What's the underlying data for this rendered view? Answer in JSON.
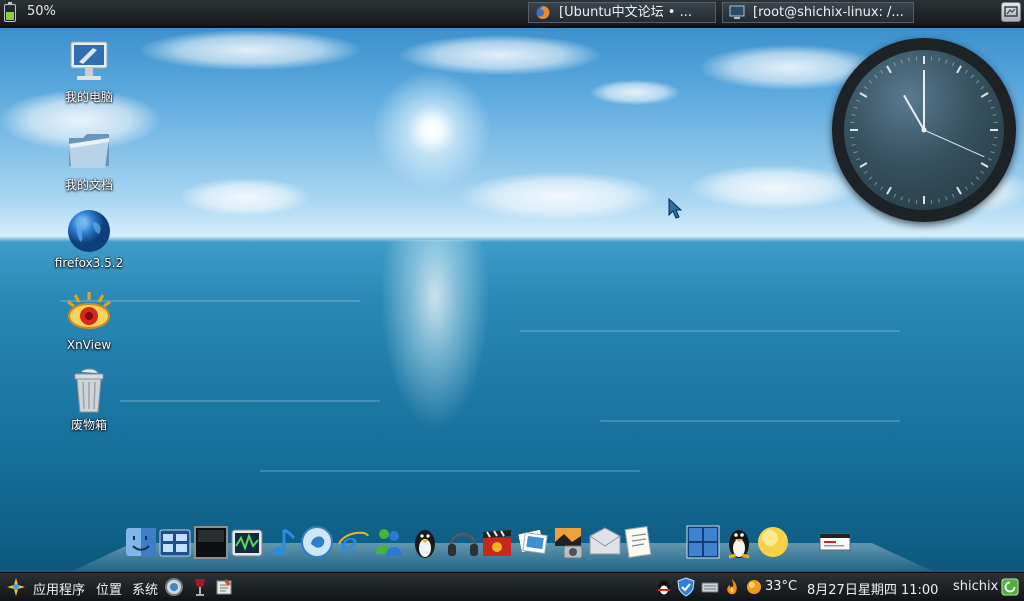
{
  "top_panel": {
    "battery_percent": "50%",
    "tasks": [
      {
        "label": "[Ubuntu中文论坛 • ...",
        "icon": "firefox-icon"
      },
      {
        "label": "[root@shichix-linux: /...",
        "icon": "terminal-icon"
      }
    ],
    "right_button_icon": "show-desktop-icon"
  },
  "desktop_icons": [
    {
      "label": "我的电脑",
      "icon": "computer-icon"
    },
    {
      "label": "我的文档",
      "icon": "folder-icon"
    },
    {
      "label": "firefox3.5.2",
      "icon": "globe-icon"
    },
    {
      "label": "XnView",
      "icon": "xnview-eye-icon"
    },
    {
      "label": "废物箱",
      "icon": "trash-icon"
    }
  ],
  "clock": {
    "hour": 11,
    "minute": 0
  },
  "dock": {
    "items": [
      "finder-icon",
      "window-list-icon",
      "black-screen-icon",
      "network-monitor-icon",
      "music-note-icon",
      "quicktime-icon",
      "internet-explorer-icon",
      "messenger-icon",
      "penguin-icon",
      "headphones-icon",
      "movie-clapper-icon",
      "photo-collection-icon",
      "camera-icon",
      "mail-icon",
      "notes-icon",
      "workspace-switcher-icon",
      "tux-icon",
      "weather-sun-icon",
      "calendar-icon"
    ]
  },
  "bottom_panel": {
    "apps_menu": "应用程序",
    "places_menu": "位置",
    "system_menu": "系统",
    "temperature": "33°C",
    "datetime": "8月27日星期四 11:00",
    "username": "shichix"
  },
  "colors": {
    "panel_bg": "#1a1f22",
    "sea_deep": "#0c5173",
    "sky_top": "#2f86c6"
  }
}
